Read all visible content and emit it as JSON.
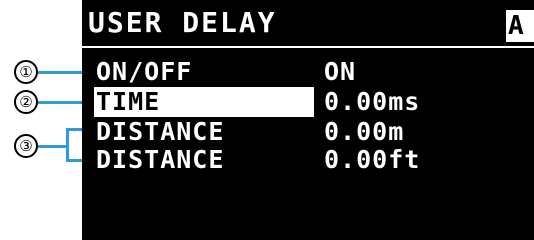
{
  "screen": {
    "title": "USER DELAY",
    "corner_badge": "A"
  },
  "rows": [
    {
      "label": "ON/OFF",
      "value": "ON",
      "selected": false
    },
    {
      "label": "TIME",
      "value": "0.00ms",
      "selected": true
    },
    {
      "label": "DISTANCE",
      "value": "0.00m",
      "selected": false
    },
    {
      "label": "DISTANCE",
      "value": "0.00ft",
      "selected": false
    }
  ],
  "callouts": [
    "①",
    "②",
    "③"
  ],
  "colors": {
    "screen_bg": "#000000",
    "text": "#ffffff",
    "selection_bg": "#ffffff",
    "leader_line": "#2e9ad6"
  }
}
